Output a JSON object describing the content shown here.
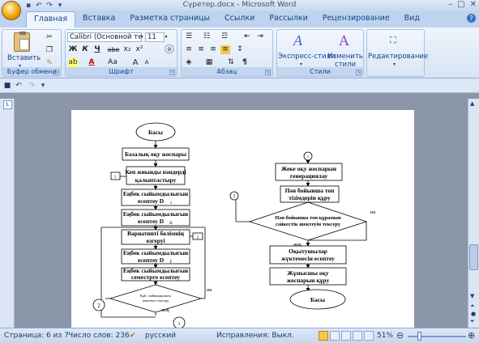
{
  "window": {
    "title": "Сүретер.docx - Microsoft Word"
  },
  "tabs": [
    "Главная",
    "Вставка",
    "Разметка страницы",
    "Ссылки",
    "Рассылки",
    "Рецензирование",
    "Вид"
  ],
  "ribbon": {
    "clipboard": {
      "label": "Буфер обмена",
      "paste": "Вставить"
    },
    "font": {
      "label": "Шрифт",
      "font_name": "Calibri (Основной те",
      "font_size": "11",
      "bold": "Ж",
      "italic": "К",
      "underline": "Ч",
      "strike": "abe",
      "subscript": "x₂",
      "superscript": "x²",
      "change_case": "Aa",
      "grow": "A",
      "shrink": "A"
    },
    "paragraph": {
      "label": "Абзац",
      "pilcrow": "¶"
    },
    "styles": {
      "label": "Стили",
      "express": "Экспресс-стили",
      "change": "Изменить стили"
    },
    "editing": {
      "label": "Редактирование"
    }
  },
  "flowchart": {
    "left": {
      "start": "Басы",
      "b1": "Базалық оқу жоспары",
      "b2a": "Кеп жиынды пәндерді",
      "b2b": "қалыптастыру",
      "b3a": "Еңбек сыйымдылығын",
      "b3b": "есептеу D",
      "b3s": "1",
      "b4a": "Еңбек сыйымдылығын",
      "b4b": "есептеу D",
      "b4s": "K",
      "b5a": "Вариативті бөлімнің",
      "b5b": "өзгеруі",
      "b6a": "Еңбек сыйымдылығын",
      "b6b": "есептеу D",
      "b6s": "F",
      "b7a": "Еңбек сыйымдылығын",
      "b7b": "семестрге есептеу",
      "d1a": "Еңб. сыйымдылығы",
      "d1b": "шектеулі тексеру",
      "yes": "ия",
      "no": "жоқ",
      "c1": "1",
      "c2": "2",
      "tag1": "1",
      "tag2": "2"
    },
    "right": {
      "c1": "1",
      "b1a": "Жеке оқу жоспарын",
      "b1b": "генерациялау",
      "b2a": "Пән бойынша топ",
      "b2b": "тізімдерін құру",
      "d1a": "Пән бойынша топ құрамын",
      "d1b": "сәйкестік шектеуін тексеру",
      "yes": "ия",
      "no": "жоқ",
      "c2": "2",
      "b3a": "Оқытушылар",
      "b3b": "жүктемесін есептеу",
      "b4a": "Жұмысшы оқу",
      "b4b": "жоспарын құру",
      "end": "Басы"
    }
  },
  "status": {
    "page": "Страница: 6 из 7",
    "words": "Число слов: 236",
    "lang": "русский",
    "track": "Исправления: Выкл.",
    "zoom": "51%"
  }
}
